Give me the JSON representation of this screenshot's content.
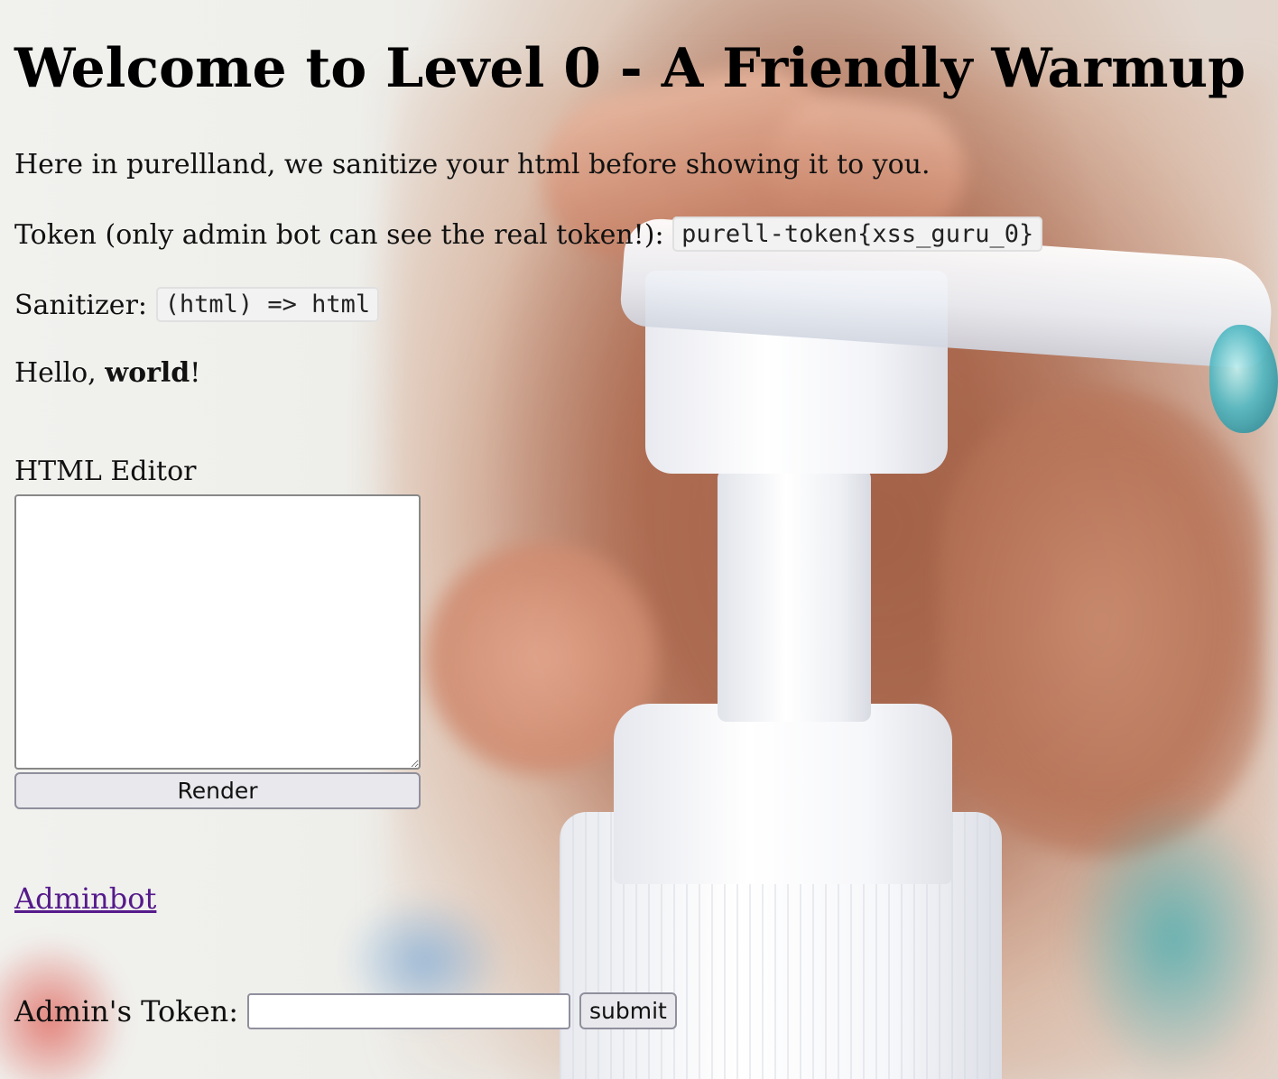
{
  "page": {
    "title": "Welcome to Level 0 - A Friendly Warmup",
    "intro": "Here in purellland, we sanitize your html before showing it to you.",
    "token_label": "Token (only admin bot can see the real token!): ",
    "token_value": "purell-token{xss_guru_0}",
    "sanitizer_label": "Sanitizer: ",
    "sanitizer_code": "(html) => html",
    "hello_prefix": "Hello, ",
    "hello_bold": "world",
    "hello_suffix": "!"
  },
  "editor": {
    "label": "HTML Editor",
    "value": "",
    "render_button": "Render"
  },
  "adminbot": {
    "link_text": "Adminbot"
  },
  "admin_token_form": {
    "label": "Admin's Token:",
    "input_value": "",
    "submit_label": "submit"
  },
  "colors": {
    "link_visited": "#551a8b",
    "button_bg": "#e9e9ed",
    "code_bg": "#f2f2f2"
  },
  "background": {
    "description_icon": "soap-pump-photo"
  }
}
